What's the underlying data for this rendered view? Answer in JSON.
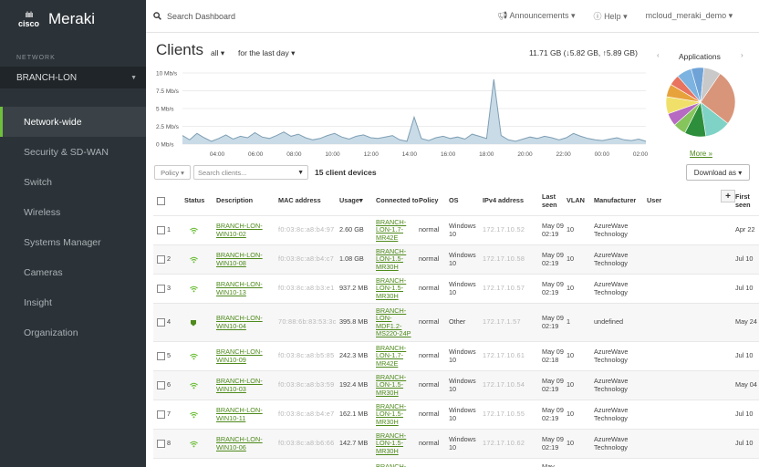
{
  "sidebar": {
    "cisco_label": "cisco",
    "brand": "Meraki",
    "network_label": "NETWORK",
    "network_value": "BRANCH-LON",
    "items": [
      {
        "label": "Network-wide",
        "active": true
      },
      {
        "label": "Security & SD-WAN"
      },
      {
        "label": "Switch"
      },
      {
        "label": "Wireless"
      },
      {
        "label": "Systems Manager"
      },
      {
        "label": "Cameras"
      },
      {
        "label": "Insight"
      },
      {
        "label": "Organization"
      }
    ]
  },
  "topbar": {
    "search_placeholder": "Search Dashboard",
    "announcements": "Announcements",
    "help": "Help",
    "user": "mcloud_meraki_demo"
  },
  "header": {
    "title": "Clients",
    "filter_type": "all",
    "filter_period": "for the last day",
    "usage_summary": "11.71 GB (↓5.82 GB, ↑5.89 GB)",
    "applications_title": "Applications",
    "more_link": "More »"
  },
  "chart_data": {
    "type": "area",
    "x_ticks": [
      "04:00",
      "06:00",
      "08:00",
      "10:00",
      "12:00",
      "14:00",
      "16:00",
      "18:00",
      "20:00",
      "22:00",
      "00:00",
      "02:00"
    ],
    "y_ticks": [
      "0 Mb/s",
      "2.5 Mb/s",
      "5 Mb/s",
      "7.5 Mb/s",
      "10 Mb/s"
    ],
    "ylim": [
      0,
      10
    ],
    "y_values": [
      1.2,
      0.6,
      1.5,
      0.9,
      0.4,
      0.8,
      1.3,
      0.7,
      1.1,
      0.9,
      1.6,
      1.0,
      0.8,
      1.2,
      1.7,
      1.1,
      1.4,
      0.9,
      0.6,
      0.8,
      1.2,
      1.5,
      1.0,
      0.7,
      1.1,
      1.3,
      0.9,
      0.8,
      1.0,
      1.2,
      0.6,
      0.4,
      3.8,
      0.8,
      0.5,
      0.9,
      1.1,
      0.8,
      1.0,
      0.7,
      1.4,
      1.1,
      0.8,
      9.1,
      1.2,
      0.6,
      0.4,
      0.7,
      1.0,
      0.8,
      1.1,
      0.9,
      0.6,
      0.9,
      1.5,
      1.1,
      0.8,
      0.6,
      0.5,
      0.7,
      0.9,
      0.6,
      0.5,
      0.7,
      0.4
    ]
  },
  "pie": {
    "slices": [
      {
        "value": 26,
        "color": "#d9957a"
      },
      {
        "value": 12,
        "color": "#7fd3c6"
      },
      {
        "value": 10,
        "color": "#2d8f3c"
      },
      {
        "value": 6,
        "color": "#86c55c"
      },
      {
        "value": 6,
        "color": "#b66ac1"
      },
      {
        "value": 8,
        "color": "#f0e06a"
      },
      {
        "value": 6,
        "color": "#e8a23c"
      },
      {
        "value": 5,
        "color": "#e8735f"
      },
      {
        "value": 7,
        "color": "#7db3e0"
      },
      {
        "value": 6,
        "color": "#6fa3d8"
      },
      {
        "value": 8,
        "color": "#c9c9c9"
      }
    ]
  },
  "toolbar": {
    "policy": "Policy",
    "search_placeholder": "Search clients...",
    "device_count": "15 client devices",
    "download": "Download as"
  },
  "table": {
    "columns": [
      "Status",
      "Description",
      "MAC address",
      "Usage",
      "Connected to",
      "Policy",
      "OS",
      "IPv4 address",
      "Last seen",
      "VLAN",
      "Manufacturer",
      "User",
      "First seen"
    ],
    "rows": [
      {
        "n": "1",
        "desc": "BRANCH-LON-WIN10-02",
        "mac": "f0:03:8c:a8:b4:97",
        "usage": "2.60 GB",
        "conn": "BRANCH-LON-1.7-MR42E",
        "policy": "normal",
        "os": "Windows 10",
        "ip": "172.17.10.52",
        "seen": "May 09 02:19",
        "vlan": "10",
        "mfr": "AzureWave Technology",
        "user": "",
        "first": "Apr 22",
        "wired": false
      },
      {
        "n": "2",
        "desc": "BRANCH-LON-WIN10-08",
        "mac": "f0:03:8c:a8:b4:c7",
        "usage": "1.08 GB",
        "conn": "BRANCH-LON-1.5-MR30H",
        "policy": "normal",
        "os": "Windows 10",
        "ip": "172.17.10.58",
        "seen": "May 09 02:19",
        "vlan": "10",
        "mfr": "AzureWave Technology",
        "user": "",
        "first": "Jul 10",
        "wired": false
      },
      {
        "n": "3",
        "desc": "BRANCH-LON-WIN10-13",
        "mac": "f0:03:8c:a8:b3:e1",
        "usage": "937.2 MB",
        "conn": "BRANCH-LON-1.5-MR30H",
        "policy": "normal",
        "os": "Windows 10",
        "ip": "172.17.10.57",
        "seen": "May 09 02:19",
        "vlan": "10",
        "mfr": "AzureWave Technology",
        "user": "",
        "first": "Jul 10",
        "wired": false
      },
      {
        "n": "4",
        "desc": "BRANCH-LON-WIN10-04",
        "mac": "70:88:6b:83:53:3c",
        "usage": "395.8 MB",
        "conn": "BRANCH-LON-MDF1.2-MS220-24P",
        "policy": "normal",
        "os": "Other",
        "ip": "172.17.1.57",
        "seen": "May 09 02:19",
        "vlan": "1",
        "mfr": "undefined",
        "user": "",
        "first": "May 24",
        "wired": true
      },
      {
        "n": "5",
        "desc": "BRANCH-LON-WIN10-09",
        "mac": "f0:03:8c:a8:b5:85",
        "usage": "242.3 MB",
        "conn": "BRANCH-LON-1.7-MR42E",
        "policy": "normal",
        "os": "Windows 10",
        "ip": "172.17.10.61",
        "seen": "May 09 02:18",
        "vlan": "10",
        "mfr": "AzureWave Technology",
        "user": "",
        "first": "Jul 10",
        "wired": false
      },
      {
        "n": "6",
        "desc": "BRANCH-LON-WIN10-03",
        "mac": "f0:03:8c:a8:b3:59",
        "usage": "192.4 MB",
        "conn": "BRANCH-LON-1.5-MR30H",
        "policy": "normal",
        "os": "Windows 10",
        "ip": "172.17.10.54",
        "seen": "May 09 02:19",
        "vlan": "10",
        "mfr": "AzureWave Technology",
        "user": "",
        "first": "May 04",
        "wired": false
      },
      {
        "n": "7",
        "desc": "BRANCH-LON-WIN10-11",
        "mac": "f0:03:8c:a8:b4:e7",
        "usage": "162.1 MB",
        "conn": "BRANCH-LON-1.5-MR30H",
        "policy": "normal",
        "os": "Windows 10",
        "ip": "172.17.10.55",
        "seen": "May 09 02:19",
        "vlan": "10",
        "mfr": "AzureWave Technology",
        "user": "",
        "first": "Jul 10",
        "wired": false
      },
      {
        "n": "8",
        "desc": "BRANCH-LON-WIN10-06",
        "mac": "f0:03:8c:a8:b6:66",
        "usage": "142.7 MB",
        "conn": "BRANCH-LON-1.5-MR30H",
        "policy": "normal",
        "os": "Windows 10",
        "ip": "172.17.10.62",
        "seen": "May 09 02:19",
        "vlan": "10",
        "mfr": "AzureWave Technology",
        "user": "",
        "first": "Jul 10",
        "wired": false
      },
      {
        "n": "",
        "desc": "",
        "mac": "",
        "usage": "",
        "conn": "BRANCH-",
        "policy": "",
        "os": "",
        "ip": "",
        "seen": "May",
        "vlan": "",
        "mfr": "",
        "user": "",
        "first": "",
        "wired": false
      }
    ]
  },
  "colors": {
    "sidebar_bg": "#2c3338",
    "accent_green": "#6fbf3d",
    "link_green": "#4e8a1c",
    "chart_fill": "#c9dbe6",
    "chart_line": "#7e9fb5"
  }
}
